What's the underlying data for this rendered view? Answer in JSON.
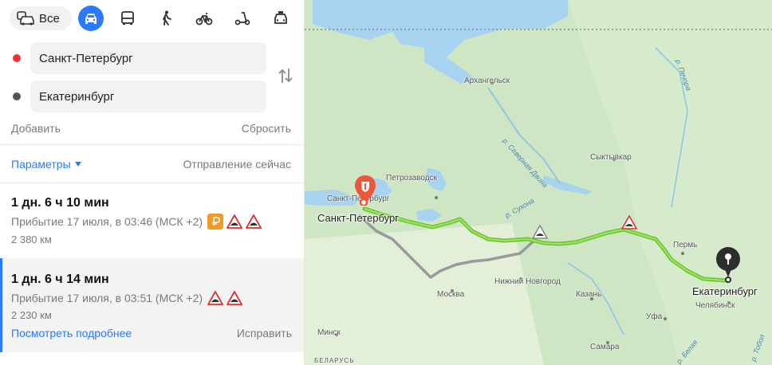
{
  "modes": {
    "all_label": "Все",
    "items": [
      {
        "name": "car",
        "icon": "car-icon",
        "active": true
      },
      {
        "name": "bus",
        "icon": "bus-icon",
        "active": false
      },
      {
        "name": "walk",
        "icon": "walk-icon",
        "active": false
      },
      {
        "name": "bike",
        "icon": "bike-icon",
        "active": false
      },
      {
        "name": "scooter",
        "icon": "scooter-icon",
        "active": false
      },
      {
        "name": "taxi",
        "icon": "taxi-icon",
        "active": false
      }
    ]
  },
  "route_form": {
    "from": "Санкт-Петербург",
    "to": "Екатеринбург",
    "add_label": "Добавить",
    "reset_label": "Сбросить",
    "from_dot_color": "#f33333",
    "to_dot_color": "#555555"
  },
  "params": {
    "label": "Параметры",
    "departure": "Отправление сейчас"
  },
  "routes": [
    {
      "duration": "1 дн. 6 ч 10 мин",
      "arrival": "Прибытие 17 июля, в 03:46 (МСК +2)",
      "distance": "2 380 км",
      "badges": [
        "toll-icon",
        "road-bump-icon",
        "road-bump-icon"
      ]
    },
    {
      "duration": "1 дн. 6 ч 14 мин",
      "arrival": "Прибытие 17 июля, в 03:51 (МСК +2)",
      "distance": "2 230 км",
      "badges": [
        "road-bump-icon",
        "road-bump-icon"
      ],
      "more_label": "Посмотреть подробнее",
      "fix_label": "Исправить"
    }
  ],
  "map": {
    "origin_label": "Санкт-Петербург",
    "destination_label": "Екатеринбург",
    "cities": {
      "arkhangelsk": "Архангельск",
      "petrozavodsk": "Петрозаводск",
      "spb_small": "Санкт-Петербург",
      "syktyvkar": "Сыктывкар",
      "perm": "Пермь",
      "nn": "Нижний Новгород",
      "moscow": "Москва",
      "kazan": "Казань",
      "ufa": "Уфа",
      "chelyabinsk": "Челябинск",
      "minsk": "Минск",
      "samara": "Самара",
      "belarus": "БЕЛАРУСЬ"
    },
    "rivers": {
      "dvina": "р. Северная Двина",
      "sukhona": "р. Сухона",
      "pechora": "р. Печора",
      "belaya": "р. Белая",
      "tobol": "р. Тобол"
    },
    "colors": {
      "land": "#cfe6c5",
      "water": "#a8d3f0",
      "main_route": "#7cd23b",
      "alt_route": "#999999",
      "pin_origin": "#f0553a",
      "pin_destination": "#333333"
    }
  }
}
